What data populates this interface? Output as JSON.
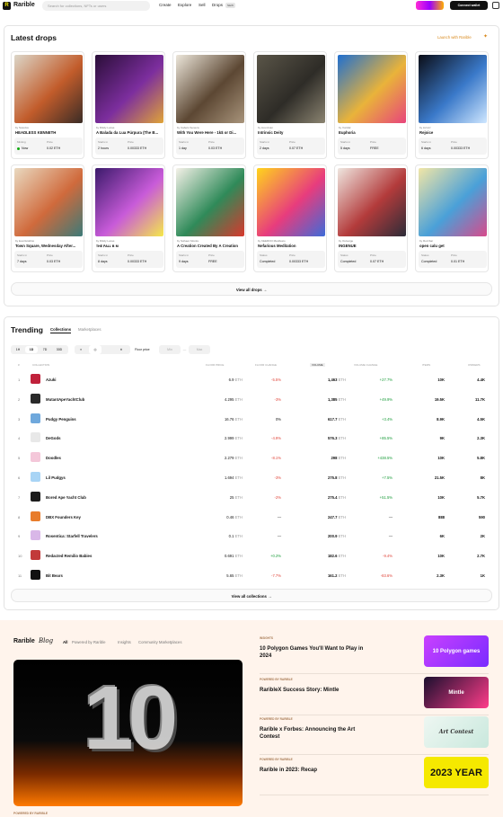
{
  "header": {
    "brand": "Rarible",
    "search_placeholder": "Search for collections, NFTs or users",
    "nav": [
      "Create",
      "Explore",
      "Sell",
      "Drops"
    ],
    "drops_badge": "NEW",
    "connect_label": "Connect wallet"
  },
  "latest_drops": {
    "title": "Latest drops",
    "launch_label": "Launch with Rarible",
    "view_all_label": "View all drops",
    "items": [
      {
        "by": "by Sotodox",
        "name": "HEADLESS KENNETH",
        "l1": "Minting",
        "v1": "Now",
        "l2": "Price",
        "v2": "0.02 ETH",
        "live": true,
        "colors": [
          "#dcd6c8",
          "#c25c2b",
          "#3a2c26"
        ]
      },
      {
        "by": "by Ritidy Lucas",
        "name": "A Balada da Lua Púrpura (The B...",
        "l1": "Starts in",
        "v1": "2 hours",
        "l2": "Price",
        "v2": "0.00333 ETH",
        "colors": [
          "#2a0e38",
          "#7c2e9e",
          "#e0a437"
        ]
      },
      {
        "by": "by Cabelo Seneca",
        "name": "With You Were Here - 1k$ or Di...",
        "l1": "Starts in",
        "v1": "1 day",
        "l2": "Price",
        "v2": "0.03 ETH",
        "colors": [
          "#ece6da",
          "#5c4733",
          "#a8947b"
        ]
      },
      {
        "by": "by lorenzvan",
        "name": "Intrinsic Deity",
        "l1": "Starts in",
        "v1": "2 days",
        "l2": "Price",
        "v2": "0.07 ETH",
        "colors": [
          "#5a5548",
          "#2e2c27",
          "#8b8471"
        ]
      },
      {
        "by": "by Xoridal",
        "name": "Euphoria",
        "l1": "Starts in",
        "v1": "5 days",
        "l2": "Price",
        "v2": "FREE",
        "colors": [
          "#1f6fd0",
          "#e9b33a",
          "#e8447c"
        ]
      },
      {
        "by": "by lorincz",
        "name": "Rejoice",
        "l1": "Starts in",
        "v1": "6 days",
        "l2": "Price",
        "v2": "0.00333 ETH",
        "colors": [
          "#0b0d16",
          "#3a79c9",
          "#cfe7ff"
        ]
      },
      {
        "by": "by Everlistobbio",
        "name": "Town Square, Wednesday After...",
        "l1": "Starts in",
        "v1": "7 days",
        "l2": "Price",
        "v2": "0.03 ETH",
        "colors": [
          "#e9d9c0",
          "#d06a3c",
          "#3c7a78"
        ]
      },
      {
        "by": "by Ritidy Lucas",
        "name": "ᴛʜᴇ ꜰᴀʟʟ ʙ ᴍ",
        "l1": "Starts in",
        "v1": "8 days",
        "l2": "Price",
        "v2": "0.00333 ETH",
        "colors": [
          "#3b1a6b",
          "#c85bd9",
          "#f4e84a"
        ]
      },
      {
        "by": "by Sohaen Monks",
        "name": "A Creation Created By A Creation",
        "l1": "Starts in",
        "v1": "9 days",
        "l2": "Price",
        "v2": "FREE",
        "colors": [
          "#f5f1e8",
          "#2f8a59",
          "#d8382d"
        ]
      },
      {
        "by": "by KEEROO Manifesto",
        "name": "Nefarious Meditation",
        "l1": "Status",
        "v1": "Completed",
        "l2": "Price",
        "v2": "0.00333 ETH",
        "colors": [
          "#ffd51c",
          "#e83c7d",
          "#3d6bd9"
        ]
      },
      {
        "by": "by Ouivarge",
        "name": "INGENUE",
        "l1": "Status",
        "v1": "Completed",
        "l2": "Price",
        "v2": "0.07 ETH",
        "colors": [
          "#efe6e0",
          "#b33b3b",
          "#2c2c38"
        ]
      },
      {
        "by": "by Rozzbar",
        "name": "open calu get",
        "l1": "Status",
        "v1": "Completed",
        "l2": "Price",
        "v2": "0.01 ETH",
        "colors": [
          "#f2e6a6",
          "#4aa0d8",
          "#d84a8b"
        ]
      }
    ]
  },
  "trending": {
    "title": "Trending",
    "tabs": [
      "Collections",
      "Marketplaces"
    ],
    "periods": [
      "1H",
      "1D",
      "7D",
      "30D"
    ],
    "chain_icons": [
      "≡",
      "◎",
      "✕"
    ],
    "floor_label": "Floor price",
    "min_placeholder": "Min",
    "max_placeholder": "Max",
    "dash": "—",
    "columns": [
      "#",
      "COLLECTION",
      "FLOOR PRICE",
      "FLOOR CHANGE",
      "VOLUME",
      "VOLUME CHANGE",
      "ITEMS",
      "OWNERS"
    ],
    "rows": [
      {
        "rank": "1",
        "name": "Azuki",
        "floor": "6.9",
        "fchg": "-5.5%",
        "vol": "1,463",
        "vchg": "+27.7%",
        "items": "10K",
        "owners": "4.4K",
        "color": "#c0213b"
      },
      {
        "rank": "2",
        "name": "MutantApeYachtClub",
        "floor": "4.295",
        "fchg": "-3%",
        "vol": "1,385",
        "vchg": "+49.9%",
        "items": "19.5K",
        "owners": "11.7K",
        "color": "#2a2a2a"
      },
      {
        "rank": "3",
        "name": "Pudgy Penguins",
        "floor": "16.76",
        "fchg": "0%",
        "vol": "617.7",
        "vchg": "+3.4%",
        "items": "8.9K",
        "owners": "4.5K",
        "color": "#6fa8dc"
      },
      {
        "rank": "4",
        "name": "DeGods",
        "floor": "2.999",
        "fchg": "-4.9%",
        "vol": "576.3",
        "vchg": "+85.5%",
        "items": "9K",
        "owners": "2.3K",
        "color": "#e8e8e8"
      },
      {
        "rank": "5",
        "name": "Doodles",
        "floor": "2.279",
        "fchg": "-8.1%",
        "vol": "298",
        "vchg": "+438.5%",
        "items": "10K",
        "owners": "5.8K",
        "color": "#f4c7d9"
      },
      {
        "rank": "6",
        "name": "Lil Pudgys",
        "floor": "1.694",
        "fchg": "-3%",
        "vol": "275.8",
        "vchg": "+7.5%",
        "items": "21.5K",
        "owners": "8K",
        "color": "#a8d4f5"
      },
      {
        "rank": "7",
        "name": "Bored Ape Yacht Club",
        "floor": "25",
        "fchg": "-2%",
        "vol": "275.4",
        "vchg": "+51.5%",
        "items": "10K",
        "owners": "5.7K",
        "color": "#1c1c1c"
      },
      {
        "rank": "8",
        "name": "DBX Founders Key",
        "floor": "0.46",
        "fchg": "—",
        "vol": "247.7",
        "vchg": "—",
        "items": "888",
        "owners": "590",
        "color": "#e87c2b"
      },
      {
        "rank": "9",
        "name": "Rosentica: Starfell Travelers",
        "floor": "0.1",
        "fchg": "—",
        "vol": "200.9",
        "vchg": "—",
        "items": "6K",
        "owners": "2K",
        "color": "#d9b7e8"
      },
      {
        "rank": "10",
        "name": "Redacted Remilio Babies",
        "floor": "0.691",
        "fchg": "+0.2%",
        "vol": "182.6",
        "vchg": "-9.4%",
        "items": "10K",
        "owners": "2.7K",
        "color": "#c23a3a"
      },
      {
        "rank": "11",
        "name": "Bit Bears",
        "floor": "5.65",
        "fchg": "-7.7%",
        "vol": "161.2",
        "vchg": "-83.6%",
        "items": "2.3K",
        "owners": "1K",
        "color": "#111111"
      }
    ],
    "unit": "ETH",
    "view_all_label": "View all collections"
  },
  "blog": {
    "brand": "Rarible",
    "script": "Blog",
    "tabs": [
      "All",
      "Powered by Rarible",
      "Insights",
      "Community Marketplaces"
    ],
    "view_all_label": "View all posts",
    "hero_number": "10",
    "hero_caption": "POWERED BY RARIBLE",
    "posts": [
      {
        "cat": "INSIGHTS",
        "title": "10 Polygon Games You'll Want to Play in 2024",
        "thumb_text": "10 Polygon games",
        "colors": [
          "#c940ff",
          "#7a2cff"
        ]
      },
      {
        "cat": "POWERED BY RARIBLE",
        "title": "RaribleX Success Story: Mintle",
        "thumb_text": "Mintle",
        "colors": [
          "#1a0f2e",
          "#ff3d8a"
        ]
      },
      {
        "cat": "POWERED BY RARIBLE",
        "title": "Rarible x Forbes: Announcing the Art Contest",
        "thumb_text": "Art Contest",
        "colors": [
          "#eef7f2",
          "#c9e8dd"
        ]
      },
      {
        "cat": "POWERED BY RARIBLE",
        "title": "Rarible in 2023: Recap",
        "thumb_text": "2023 YEAR",
        "colors": [
          "#f5e900",
          "#f5e900"
        ]
      }
    ]
  }
}
